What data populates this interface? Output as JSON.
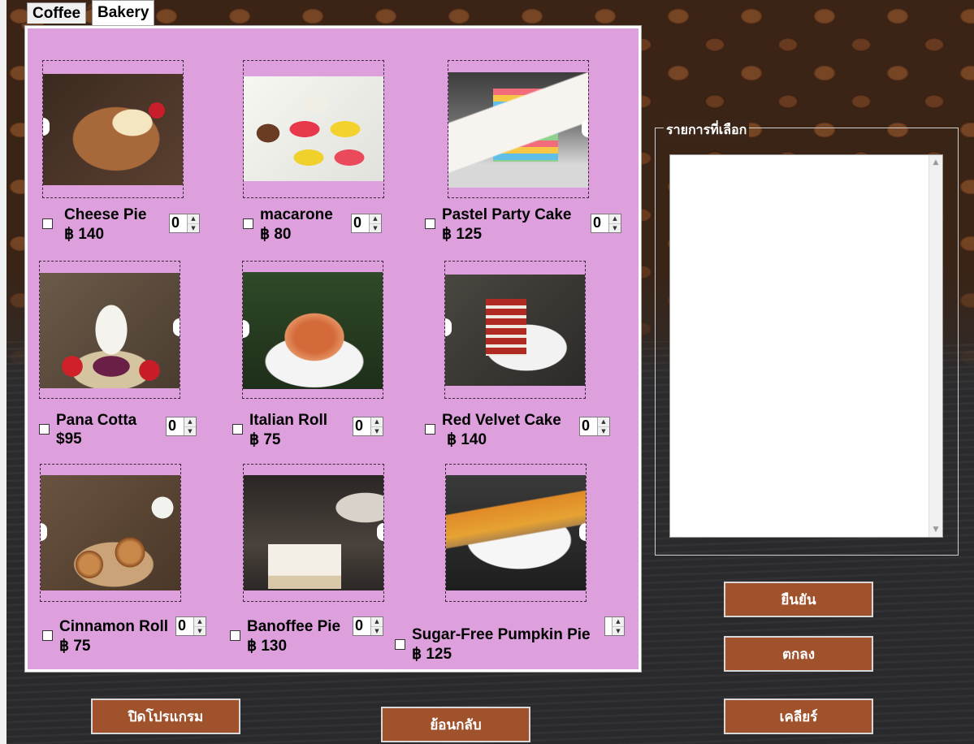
{
  "tabs": [
    {
      "label": "Coffee",
      "active": false
    },
    {
      "label": "Bakery",
      "active": true
    }
  ],
  "items": [
    {
      "name": "Cheese Pie",
      "price": "฿ 140",
      "qty": "0",
      "icon": "cheese-pie-photo"
    },
    {
      "name": "macarone",
      "price": "฿ 80",
      "qty": "0",
      "icon": "macaron-photo"
    },
    {
      "name": "Pastel Party Cake",
      "price": "฿ 125",
      "qty": "0",
      "icon": "rainbow-cake-photo"
    },
    {
      "name": "Pana Cotta",
      "price": "$95",
      "qty": "0",
      "icon": "panna-cotta-photo"
    },
    {
      "name": "Italian Roll",
      "price": "฿ 75",
      "qty": "0",
      "icon": "italian-roll-photo"
    },
    {
      "name": "Red Velvet Cake",
      "price": "฿ 140",
      "qty": "0",
      "icon": "red-velvet-photo"
    },
    {
      "name": "Cinnamon Roll",
      "price": "฿ 75",
      "qty": "0",
      "icon": "cinnamon-roll-photo"
    },
    {
      "name": "Banoffee Pie",
      "price": "฿ 130",
      "qty": "0",
      "icon": "banoffee-pie-photo"
    },
    {
      "name": "Sugar-Free Pumpkin Pie",
      "price": "฿ 125",
      "qty": "",
      "icon": "pumpkin-pie-photo"
    }
  ],
  "selection": {
    "legend": "รายการที่เลือก"
  },
  "buttons": {
    "confirm": "ยืนยัน",
    "ok": "ตกลง",
    "clear": "เคลียร์",
    "close_program": "ปิดโปรแกรม",
    "back": "ย้อนกลับ"
  },
  "colors": {
    "panel": "#dda0dd",
    "button": "#a0522d"
  }
}
